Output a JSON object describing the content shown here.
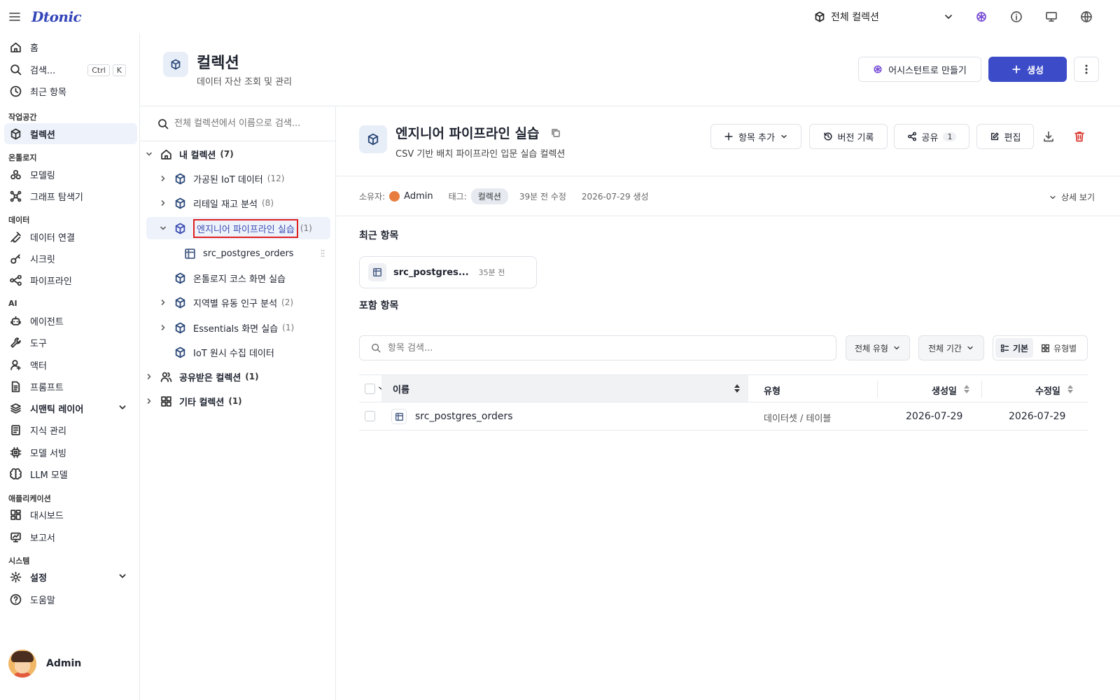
{
  "topbar": {
    "logo": "Dtonic",
    "scope_label": "전체 컬렉션"
  },
  "sidebar": {
    "home": "홈",
    "search": "검색...",
    "search_kbd": [
      "Ctrl",
      "K"
    ],
    "recent": "최근 항목",
    "sections": [
      {
        "label": "작업공간",
        "items": [
          "컬렉션"
        ]
      },
      {
        "label": "온톨로지",
        "items": [
          "모델링",
          "그래프 탐색기"
        ]
      },
      {
        "label": "데이터",
        "items": [
          "데이터 연결",
          "시크릿",
          "파이프라인"
        ]
      },
      {
        "label": "AI",
        "items": [
          "에이전트",
          "도구",
          "액터",
          "프롬프트",
          "시맨틱 레이어",
          "지식 관리",
          "모델 서빙",
          "LLM 모델"
        ]
      },
      {
        "label": "애플리케이션",
        "items": [
          "대시보드",
          "보고서"
        ]
      },
      {
        "label": "시스템",
        "items": [
          "설정",
          "도움말"
        ]
      }
    ],
    "user_name": "Admin"
  },
  "page": {
    "title": "컬렉션",
    "subtitle": "데이터 자산 조회 및 관리",
    "assistant_btn": "어시스턴트로 만들기",
    "create_btn": "생성"
  },
  "tree": {
    "search_placeholder": "전체 컬렉션에서 이름으로 검색...",
    "my_collections": {
      "label": "내 컬렉션",
      "count": "(7)"
    },
    "items": [
      {
        "label": "가공된 IoT 데이터",
        "count": "(12)"
      },
      {
        "label": "리테일 재고 분석",
        "count": "(8)"
      },
      {
        "label": "엔지니어 파이프라인 실습",
        "count": "(1)"
      },
      {
        "label": "src_postgres_orders",
        "count": ""
      },
      {
        "label": "온톨로지 코스 화면 실습",
        "count": ""
      },
      {
        "label": "지역별 유동 인구 분석",
        "count": "(2)"
      },
      {
        "label": "Essentials 화면 실습",
        "count": "(1)"
      },
      {
        "label": "IoT 원시 수집 데이터",
        "count": ""
      }
    ],
    "shared": {
      "label": "공유받은 컬렉션",
      "count": "(1)"
    },
    "other": {
      "label": "기타 컬렉션",
      "count": "(1)"
    }
  },
  "detail": {
    "title": "엔지니어 파이프라인 실습",
    "subtitle": "CSV 기반 배치 파이프라인 입문 실습 컬렉션",
    "add_item": "항목 추가",
    "version_history": "버전 기록",
    "share": "공유",
    "share_count": "1",
    "edit": "편집",
    "meta": {
      "owner_label": "소유자:",
      "owner": "Admin",
      "tag_label": "태그:",
      "tag": "컬렉션",
      "modified": "39분 전 수정",
      "created": "2026-07-29 생성",
      "details_toggle": "상세 보기"
    },
    "recent_title": "최근 항목",
    "recent_item": {
      "name": "src_postgres...",
      "time": "35분 전"
    },
    "contains_title": "포함 항목",
    "item_search_placeholder": "항목 검색...",
    "filter_type": "전체 유형",
    "filter_period": "전체 기간",
    "view_basic": "기본",
    "view_by_type": "유형별",
    "table": {
      "headers": {
        "name": "이름",
        "type": "유형",
        "created": "생성일",
        "modified": "수정일"
      },
      "rows": [
        {
          "name": "src_postgres_orders",
          "type": "데이터셋 / 테이블",
          "created": "2026-07-29",
          "modified": "2026-07-29"
        }
      ]
    }
  }
}
